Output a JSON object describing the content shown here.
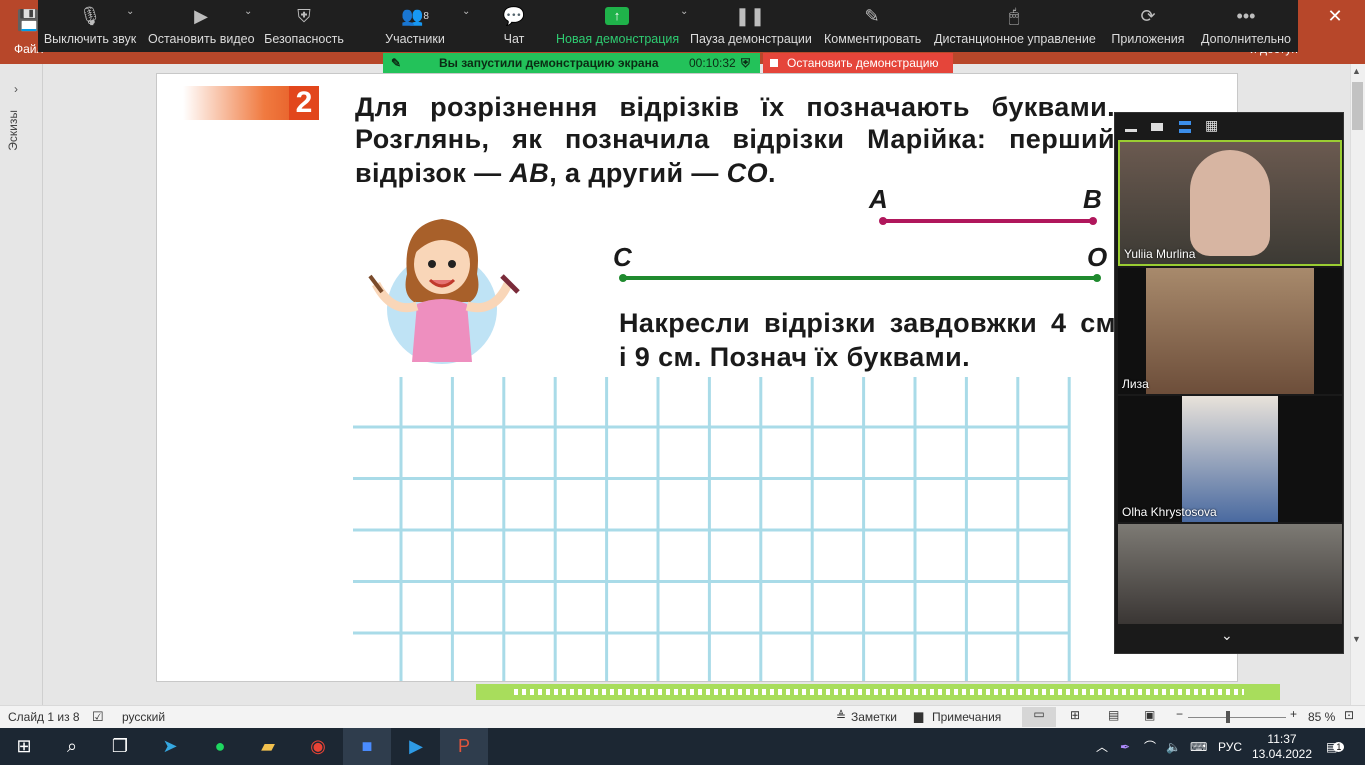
{
  "ppt": {
    "file_label": "Файл",
    "share_label": "й доступ"
  },
  "zoom_toolbar": {
    "mute": "Выключить звук",
    "video": "Остановить видео",
    "security": "Безопасность",
    "participants": "Участники",
    "participants_count": "8",
    "chat": "Чат",
    "new_share": "Новая демонстрация",
    "pause_share": "Пауза демонстрации",
    "annotate": "Комментировать",
    "remote_control": "Дистанционное управление",
    "apps": "Приложения",
    "more": "Дополнительно"
  },
  "share_banner": {
    "text": "Вы запустили демонстрацию экрана",
    "timer": "00:10:32",
    "stop": "Остановить демонстрацию"
  },
  "rail": {
    "label": "Эскизы"
  },
  "slide": {
    "badge_number": "2",
    "p1_line1": "Для розрізнення відрізків їх позначають буквами.",
    "p1_line2": "Розглянь, як позначила відрізки Марійка: перший",
    "p1_line3_a": "відрізок — ",
    "p1_line3_b": "AB",
    "p1_line3_c": ", а другий — ",
    "p1_line3_d": "CO",
    "p1_line3_e": ".",
    "point_a": "A",
    "point_b": "B",
    "point_c": "C",
    "point_o": "O",
    "p2_line1": "Накресли відрізки завдовжки 4 см",
    "p2_line2": "і 9 см. Познач їх буквами."
  },
  "participants": [
    {
      "name": "Yuliia Murlina"
    },
    {
      "name": "Лиза"
    },
    {
      "name": "Olha Khrystosova"
    },
    {
      "name": ""
    }
  ],
  "status_bar": {
    "slide": "Слайд 1 из 8",
    "language": "русский",
    "notes": "Заметки",
    "comments": "Примечания",
    "zoom": "85 %"
  },
  "taskbar": {
    "lang": "РУС",
    "time": "11:37",
    "date": "13.04.2022",
    "notifications": "1"
  },
  "colors": {
    "accent_zoom_green": "#23c25a",
    "stop_red": "#e5453a",
    "segment_ab": "#b0175c",
    "segment_co": "#1f8a2e",
    "ppt_brand": "#b7472a"
  }
}
